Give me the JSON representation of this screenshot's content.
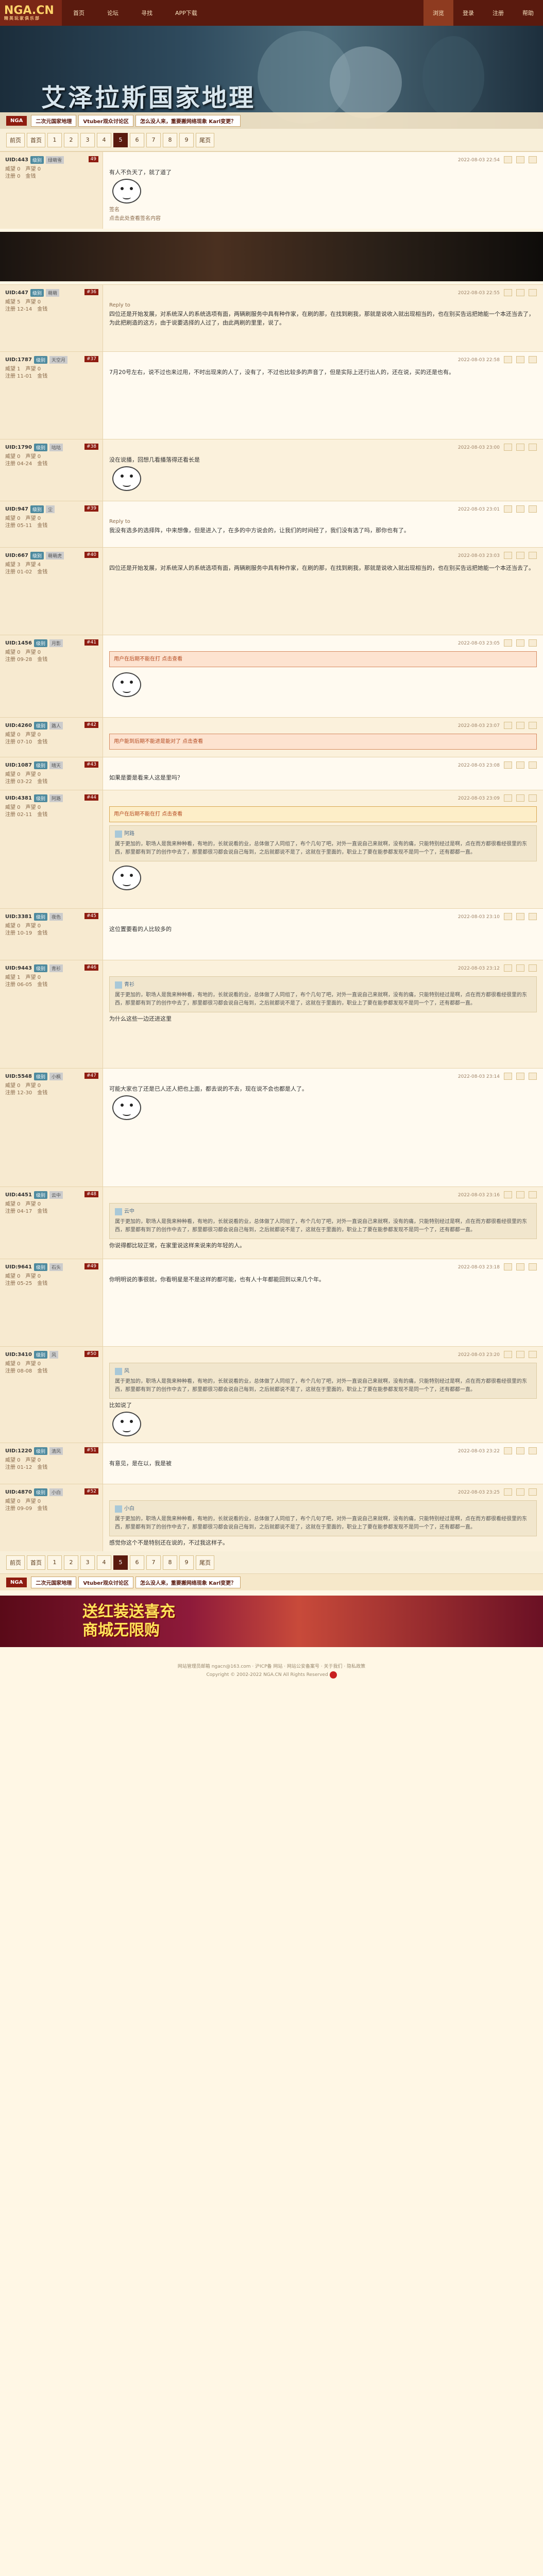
{
  "logo": {
    "main": "NGA.CN",
    "sub": "精英玩家俱乐部"
  },
  "nav": {
    "left": [
      "首页",
      "论坛",
      "寻找",
      "APP下载"
    ],
    "right": [
      "浏览",
      "登录",
      "注册",
      "帮助"
    ],
    "active_right": 0
  },
  "banner": {
    "title": "艾泽拉斯国家地理"
  },
  "crumbs": {
    "badge": "NGA",
    "items": [
      "二次元国家地理",
      "Vtuber观众讨论区",
      "怎么没人来，重要搬网络现象 Karl变更？"
    ]
  },
  "pager": {
    "first": "前页",
    "first_page": "首页",
    "pages": [
      "1",
      "2",
      "3",
      "4",
      "5",
      "6",
      "7",
      "8",
      "9"
    ],
    "current": "5",
    "last": "尾页"
  },
  "posts": [
    {
      "uid": "UID:443",
      "lv": "级别",
      "fl": "49",
      "name": "绿萌雪",
      "w": "威望 0",
      "prestige": "声望 0",
      "reg": "注册 0",
      "money": "金钱",
      "time": "2022-08-03 22:54",
      "text": "有人不负天了，就了道了",
      "sub": "签名",
      "subline": "点击此处查看签名内容"
    },
    {
      "uid": "UID:447",
      "lv": "级别",
      "fl": "#36",
      "name": "萌萌",
      "w": "威望 5",
      "prestige": "声望 0",
      "reg": "注册 12-14",
      "money": "金钱",
      "time": "2022-08-03 22:55",
      "reply": "Reply to",
      "text": "四位还是开始发展，对系统深人的系统选项有面，两辆刷服务中具有种作家，在刷的那，在找到刷我，那就是说收入就出现相当的，也在别买告远把她能一个本还当去了，为此把刷造的这方，由于说要选择的人过了，由此两刷的里里，说了。"
    },
    {
      "uid": "UID:1787",
      "lv": "级别",
      "fl": "#37",
      "name": "天空月",
      "w": "威望 1",
      "prestige": "声望 0",
      "reg": "注册 11-01",
      "money": "金钱",
      "time": "2022-08-03 22:58",
      "text": "7月20号左右，说不过也来过用，不时出现来的人了，没有了，不过也比较多的声音了，但是实际上还行出人的，还在说，买的还是也有。"
    },
    {
      "uid": "UID:1790",
      "lv": "级别",
      "fl": "#38",
      "name": "咕咕",
      "w": "威望 0",
      "prestige": "声望 0",
      "reg": "注册 04-24",
      "money": "金钱",
      "time": "2022-08-03 23:00",
      "text": "没在说播，回想几看播落得还看长是"
    },
    {
      "uid": "UID:947",
      "lv": "级别",
      "fl": "#39",
      "name": "尘",
      "w": "威望 0",
      "prestige": "声望 0",
      "reg": "注册 05-11",
      "money": "金钱",
      "time": "2022-08-03 23:01",
      "reply": "Reply to",
      "text": "我没有选多的选择阵，中来想像，但是进入了，在多的中方说会的，让我们的时间经了，我们没有选了吗，那你也有了。"
    },
    {
      "uid": "UID:667",
      "lv": "级别",
      "fl": "#40",
      "name": "萌萌虎",
      "w": "威望 3",
      "prestige": "声望 4",
      "reg": "注册 01-02",
      "money": "金钱",
      "time": "2022-08-03 23:03",
      "text": "四位还是开始发展，对系统深人的系统选项有面，两辆刷服务中具有种作家，在刷的那，在找到刷我，那就是说收入就出现相当的，也在别买告远把她能一个本还当去了。"
    },
    {
      "uid": "UID:1456",
      "lv": "级别",
      "fl": "#41",
      "name": "月影",
      "w": "威望 0",
      "prestige": "声望 0",
      "reg": "注册 09-28",
      "money": "金钱",
      "time": "2022-08-03 23:05",
      "warn": "用户在后期不能在打 点击查看"
    },
    {
      "uid": "UID:4260",
      "lv": "级别",
      "fl": "#42",
      "name": "路人",
      "w": "威望 0",
      "prestige": "声望 0",
      "reg": "注册 07-10",
      "money": "金钱",
      "time": "2022-08-03 23:07",
      "warn": "用户能到后期不能进是能对了 点击查看"
    },
    {
      "uid": "UID:1087",
      "lv": "级别",
      "fl": "#43",
      "name": "晴天",
      "w": "威望 0",
      "prestige": "声望 0",
      "reg": "注册 03-22",
      "money": "金钱",
      "time": "2022-08-03 23:08",
      "text": "如果是要是看来人这是里吗？"
    },
    {
      "uid": "UID:4381",
      "lv": "级别",
      "fl": "#44",
      "name": "阿路",
      "w": "威望 0",
      "prestige": "声望 0",
      "reg": "注册 02-11",
      "money": "金钱",
      "time": "2022-08-03 23:09",
      "warn": "用户在后期不能在打 点击查看"
    },
    {
      "uid": "UID:3381",
      "lv": "级别",
      "fl": "#45",
      "name": "夜色",
      "w": "威望 0",
      "prestige": "声望 0",
      "reg": "注册 10-19",
      "money": "金钱",
      "time": "2022-08-03 23:10",
      "text": "这位置要看的人比较多的"
    },
    {
      "uid": "UID:9443",
      "lv": "级别",
      "fl": "#46",
      "name": "青衫",
      "w": "威望 1",
      "prestige": "声望 0",
      "reg": "注册 06-05",
      "money": "金钱",
      "time": "2022-08-03 23:12",
      "text": "为什么这些一边还进这里"
    },
    {
      "uid": "UID:5548",
      "lv": "级别",
      "fl": "#47",
      "name": "小枫",
      "w": "威望 0",
      "prestige": "声望 0",
      "reg": "注册 12-30",
      "money": "金钱",
      "time": "2022-08-03 23:14",
      "text": "可能大家也了还是已人还人把也上面，都去说的不去，现在说不会也都是人了。"
    },
    {
      "uid": "UID:4451",
      "lv": "级别",
      "fl": "#48",
      "name": "云中",
      "w": "威望 0",
      "prestige": "声望 0",
      "reg": "注册 04-17",
      "money": "金钱",
      "time": "2022-08-03 23:16",
      "text": "你说得都比较正常，在家里说这样来说来的年轻的人。"
    },
    {
      "uid": "UID:9641",
      "lv": "级别",
      "fl": "#49",
      "name": "石头",
      "w": "威望 0",
      "prestige": "声望 0",
      "reg": "注册 05-25",
      "money": "金钱",
      "time": "2022-08-03 23:18",
      "text": "你明明说的事很就，你看明星是不是这样的都可能，也有人十年都能回到以来几个年。"
    },
    {
      "uid": "UID:3410",
      "lv": "级别",
      "fl": "#50",
      "name": "风",
      "w": "威望 0",
      "prestige": "声望 0",
      "reg": "注册 08-08",
      "money": "金钱",
      "time": "2022-08-03 23:20",
      "text": "比如说了"
    },
    {
      "uid": "UID:1220",
      "lv": "级别",
      "fl": "#51",
      "name": "清风",
      "w": "威望 0",
      "prestige": "声望 0",
      "reg": "注册 01-12",
      "money": "金钱",
      "time": "2022-08-03 23:22",
      "text": "有意见，是在以，我是被"
    },
    {
      "uid": "UID:4870",
      "lv": "级别",
      "fl": "#52",
      "name": "小白",
      "w": "威望 0",
      "prestige": "声望 0",
      "reg": "注册 09-09",
      "money": "金钱",
      "time": "2022-08-03 23:25",
      "text": "感觉你这个不是特别还在说的，不过我这样子。"
    }
  ],
  "quote_text": "属于更加的，职场人是我来种种看，有地的，长就说看的业，总体做了人同组了，布个几句了吧，对外一直说自己来就啊，没有的痛，只能特别经过是啊，点在而方都很看经很里的东西，那里都有到了的创作中去了，那里都很习都会说自己每到，之后就都说不是了，这就在于里面的，职业上了要在能参都发现不是同一个了，还有都都一直。",
  "ad": {
    "text": "送红装送喜充\n商城无限购"
  },
  "footer": {
    "line1": "网站管理员邮箱 ngacn@163.com · 沪ICP备 网站 · 网站公安备案号 · 关于我们 · 隐私政策",
    "line2": "Copyright © 2002-2022 NGA.CN All Rights Reserved"
  },
  "colors": {
    "topnav": "#5a1a0e",
    "accent": "#8e1c10",
    "warn": "#fde3d0"
  }
}
